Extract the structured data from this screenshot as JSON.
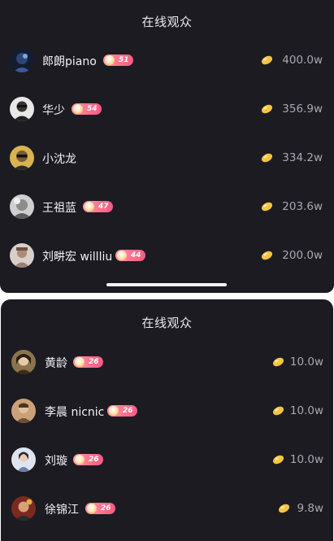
{
  "top_panel": {
    "title": "在线观众",
    "viewers": [
      {
        "name": "郎朗piano",
        "level": "51",
        "amount": "400.0w",
        "avatar_color": "#1b2a4a"
      },
      {
        "name": "华少",
        "level": "54",
        "amount": "356.9w",
        "avatar_color": "#d9d9d9"
      },
      {
        "name": "小沈龙",
        "level": "",
        "amount": "334.2w",
        "avatar_color": "#c9a24a"
      },
      {
        "name": "王祖蓝",
        "level": "47",
        "amount": "203.6w",
        "avatar_color": "#bdbdbd"
      },
      {
        "name": "刘畊宏 willliu",
        "level": "44",
        "amount": "200.0w",
        "avatar_color": "#b7a7a0"
      }
    ]
  },
  "bottom_panel": {
    "title": "在线观众",
    "viewers": [
      {
        "name": "黄龄",
        "level": "26",
        "amount": "10.0w",
        "avatar_color": "#6b5a3a"
      },
      {
        "name": "李晨 nicnic",
        "level": "26",
        "amount": "10.0w",
        "avatar_color": "#a07a52"
      },
      {
        "name": "刘璇",
        "level": "26",
        "amount": "10.0w",
        "avatar_color": "#cfd6e6"
      },
      {
        "name": "徐锦江",
        "level": "26",
        "amount": "9.8w",
        "avatar_color": "#8a3a2a"
      }
    ]
  },
  "colors": {
    "panel_bg": "#1c1b22",
    "badge_pink": "#ff6f8c",
    "bean_gold": "#f5c542",
    "amount_gray": "#a9a8b3"
  },
  "icons": {
    "currency": "gold-bean-icon",
    "badge": "fan-level-badge"
  }
}
